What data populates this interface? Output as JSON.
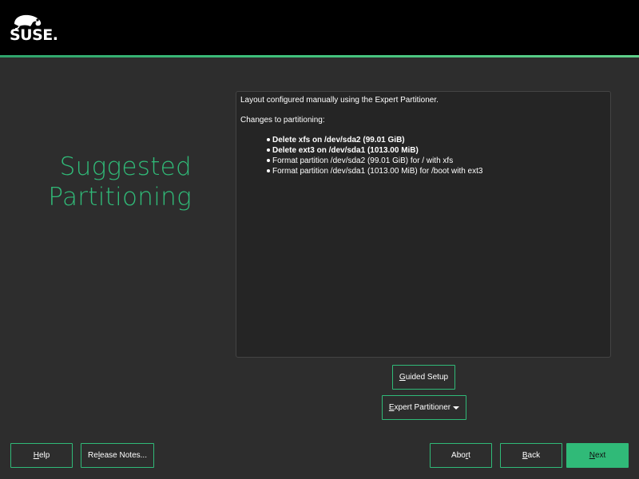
{
  "brand": {
    "logo_text": "SUSE.",
    "accent_color": "#30ba78",
    "header_color": "#000000",
    "background_color": "#2d2d2d"
  },
  "page": {
    "title_line1": "Suggested",
    "title_line2": "Partitioning"
  },
  "summary": {
    "intro": "Layout configured manually using the Expert Partitioner.",
    "changes_heading": "Changes to partitioning:",
    "changes": [
      {
        "text": "Delete xfs on /dev/sda2 (99.01 GiB)",
        "bold": true
      },
      {
        "text": "Delete ext3 on /dev/sda1 (1013.00 MiB)",
        "bold": true
      },
      {
        "text": "Format partition /dev/sda2 (99.01 GiB) for / with xfs",
        "bold": false
      },
      {
        "text": "Format partition /dev/sda1 (1013.00 MiB) for /boot with ext3",
        "bold": false
      }
    ]
  },
  "buttons": {
    "guided_setup": {
      "mnemonic": "G",
      "rest": "uided Setup"
    },
    "expert_partitioner": {
      "mnemonic": "E",
      "rest": "xpert Partitioner"
    },
    "help": {
      "mnemonic": "H",
      "rest": "elp"
    },
    "release_notes": {
      "before": "Re",
      "mnemonic": "l",
      "rest": "ease Notes..."
    },
    "abort": {
      "before": "Abo",
      "mnemonic": "r",
      "rest": "t"
    },
    "back": {
      "mnemonic": "B",
      "rest": "ack"
    },
    "next": {
      "mnemonic": "N",
      "rest": "ext"
    }
  }
}
